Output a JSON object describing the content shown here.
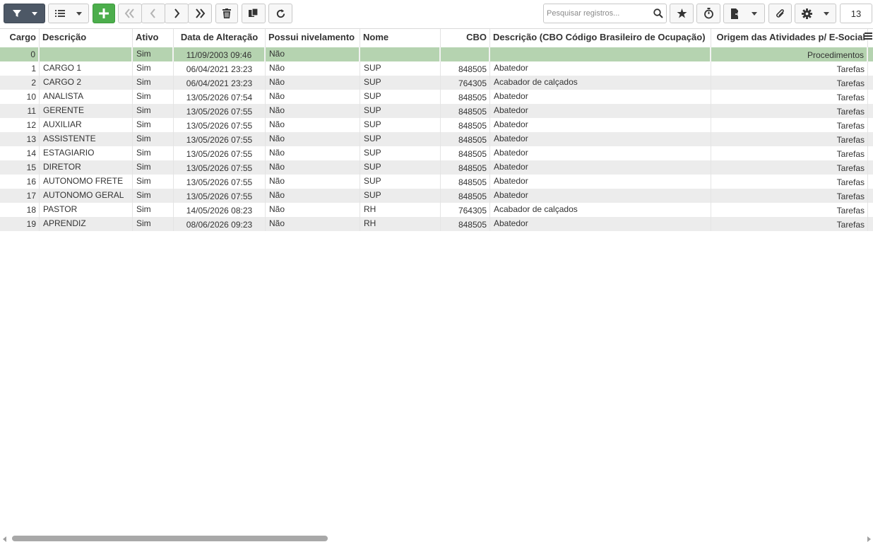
{
  "toolbar": {
    "search_placeholder": "Pesquisar registros...",
    "page_number": "13"
  },
  "table": {
    "columns": {
      "cargo": "Cargo",
      "descricao": "Descrição",
      "ativo": "Ativo",
      "data": "Data de Alteração",
      "nivelamento": "Possui nivelamento",
      "nome": "Nome",
      "cbo": "CBO",
      "cbo_desc": "Descrição (CBO Código Brasileiro de Ocupação)",
      "origem": "Origem das Atividades p/ E-Social"
    },
    "rows": [
      {
        "cargo": "0",
        "descricao": "",
        "ativo": "Sim",
        "data": "11/09/2003 09:46",
        "nivelamento": "Não",
        "nome": "",
        "cbo": "",
        "cbo_desc": "",
        "origem": "Procedimentos"
      },
      {
        "cargo": "1",
        "descricao": "CARGO 1",
        "ativo": "Sim",
        "data": "06/04/2021 23:23",
        "nivelamento": "Não",
        "nome": "SUP",
        "cbo": "848505",
        "cbo_desc": "Abatedor",
        "origem": "Tarefas"
      },
      {
        "cargo": "2",
        "descricao": "CARGO 2",
        "ativo": "Sim",
        "data": "06/04/2021 23:23",
        "nivelamento": "Não",
        "nome": "SUP",
        "cbo": "764305",
        "cbo_desc": "Acabador de calçados",
        "origem": "Tarefas"
      },
      {
        "cargo": "10",
        "descricao": "ANALISTA",
        "ativo": "Sim",
        "data": "13/05/2026 07:54",
        "nivelamento": "Não",
        "nome": "SUP",
        "cbo": "848505",
        "cbo_desc": "Abatedor",
        "origem": "Tarefas"
      },
      {
        "cargo": "11",
        "descricao": "GERENTE",
        "ativo": "Sim",
        "data": "13/05/2026 07:55",
        "nivelamento": "Não",
        "nome": "SUP",
        "cbo": "848505",
        "cbo_desc": "Abatedor",
        "origem": "Tarefas"
      },
      {
        "cargo": "12",
        "descricao": "AUXILIAR",
        "ativo": "Sim",
        "data": "13/05/2026 07:55",
        "nivelamento": "Não",
        "nome": "SUP",
        "cbo": "848505",
        "cbo_desc": "Abatedor",
        "origem": "Tarefas"
      },
      {
        "cargo": "13",
        "descricao": "ASSISTENTE",
        "ativo": "Sim",
        "data": "13/05/2026 07:55",
        "nivelamento": "Não",
        "nome": "SUP",
        "cbo": "848505",
        "cbo_desc": "Abatedor",
        "origem": "Tarefas"
      },
      {
        "cargo": "14",
        "descricao": "ESTAGIARIO",
        "ativo": "Sim",
        "data": "13/05/2026 07:55",
        "nivelamento": "Não",
        "nome": "SUP",
        "cbo": "848505",
        "cbo_desc": "Abatedor",
        "origem": "Tarefas"
      },
      {
        "cargo": "15",
        "descricao": "DIRETOR",
        "ativo": "Sim",
        "data": "13/05/2026 07:55",
        "nivelamento": "Não",
        "nome": "SUP",
        "cbo": "848505",
        "cbo_desc": "Abatedor",
        "origem": "Tarefas"
      },
      {
        "cargo": "16",
        "descricao": "AUTONOMO FRETE",
        "ativo": "Sim",
        "data": "13/05/2026 07:55",
        "nivelamento": "Não",
        "nome": "SUP",
        "cbo": "848505",
        "cbo_desc": "Abatedor",
        "origem": "Tarefas"
      },
      {
        "cargo": "17",
        "descricao": "AUTONOMO GERAL",
        "ativo": "Sim",
        "data": "13/05/2026 07:55",
        "nivelamento": "Não",
        "nome": "SUP",
        "cbo": "848505",
        "cbo_desc": "Abatedor",
        "origem": "Tarefas"
      },
      {
        "cargo": "18",
        "descricao": "PASTOR",
        "ativo": "Sim",
        "data": "14/05/2026 08:23",
        "nivelamento": "Não",
        "nome": "RH",
        "cbo": "764305",
        "cbo_desc": "Acabador de calçados",
        "origem": "Tarefas"
      },
      {
        "cargo": "19",
        "descricao": "APRENDIZ",
        "ativo": "Sim",
        "data": "08/06/2026 09:23",
        "nivelamento": "Não",
        "nome": "RH",
        "cbo": "848505",
        "cbo_desc": "Abatedor",
        "origem": "Tarefas"
      }
    ]
  },
  "colors": {
    "selected_row": "#b5d3b0",
    "striped_row": "#ececec",
    "filter_button": "#4d5866",
    "add_button": "#4cae4c"
  },
  "icons": [
    "filter-icon",
    "list-icon",
    "plus-icon",
    "first-page-icon",
    "prev-icon",
    "next-icon",
    "last-page-icon",
    "trash-icon",
    "copy-icon",
    "refresh-icon",
    "search-icon",
    "star-icon",
    "timer-icon",
    "export-icon",
    "paperclip-icon",
    "gear-icon",
    "column-menu-icon"
  ]
}
